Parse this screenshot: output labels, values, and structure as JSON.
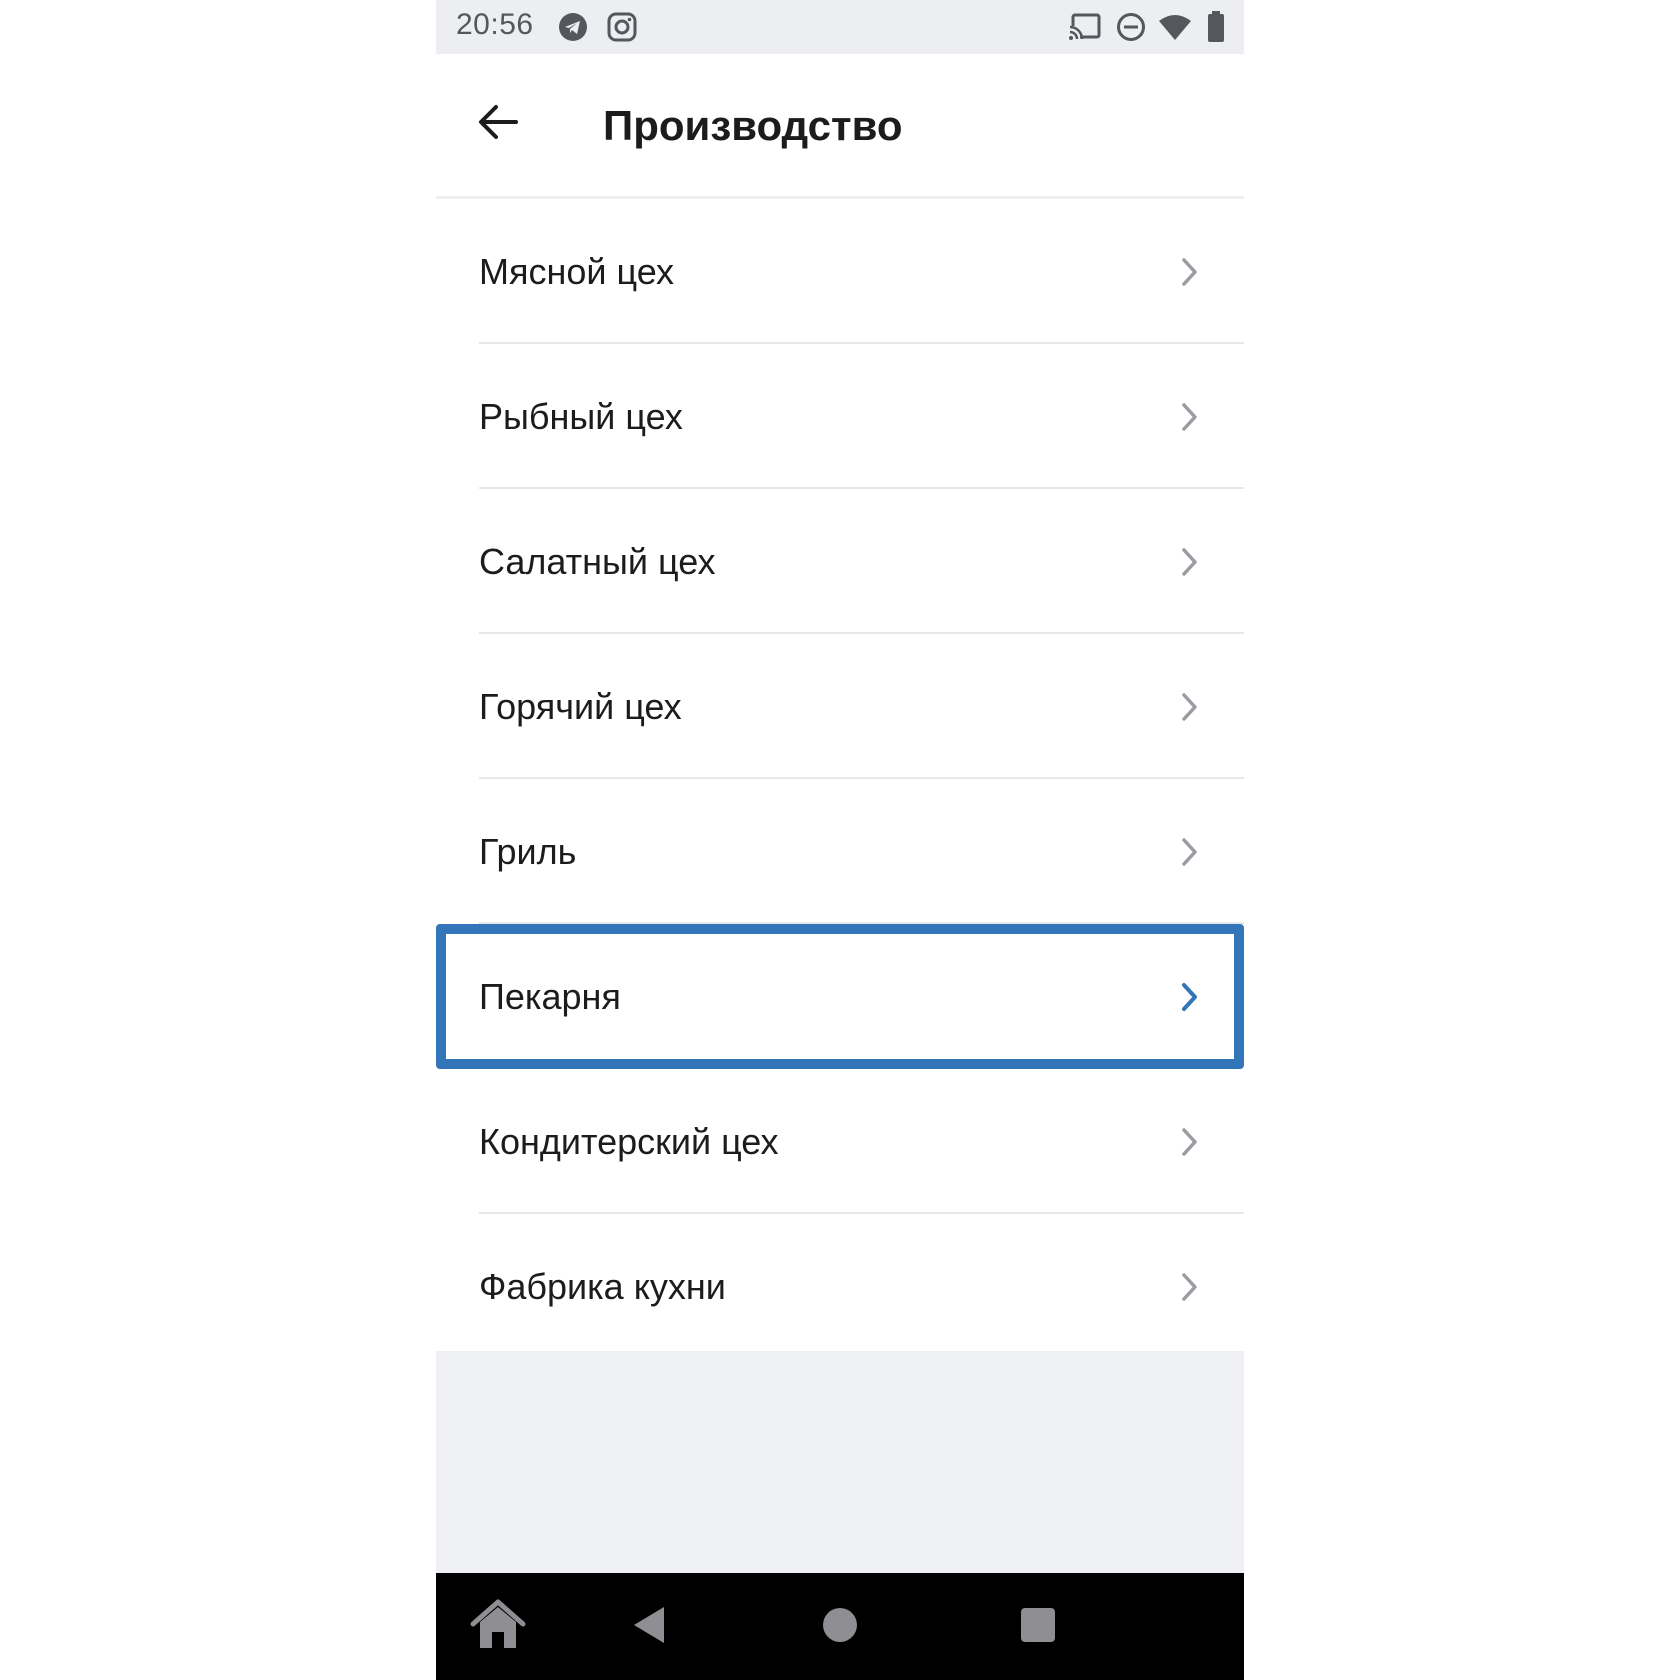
{
  "status_bar": {
    "time": "20:56",
    "left_icons": [
      "telegram-icon",
      "instagram-icon"
    ],
    "right_icons": [
      "cast-icon",
      "do-not-disturb-icon",
      "wifi-icon",
      "battery-icon"
    ]
  },
  "header": {
    "title": "Производство",
    "back_icon": "arrow-left-icon"
  },
  "list": {
    "items": [
      {
        "label": "Мясной цех"
      },
      {
        "label": "Рыбный цех"
      },
      {
        "label": "Салатный цех"
      },
      {
        "label": "Горячий цех"
      },
      {
        "label": "Гриль"
      },
      {
        "label": "Пекарня",
        "selected": true
      },
      {
        "label": "Кондитерский цех"
      },
      {
        "label": "Фабрика кухни"
      }
    ]
  },
  "nav_bar": {
    "buttons": [
      "home-icon",
      "back-triangle-icon",
      "home-circle-icon",
      "recents-square-icon"
    ]
  },
  "colors": {
    "accent": "#3275b8",
    "chevron": "#9a9ca1",
    "status_bar_bg": "#eceef2",
    "nav_bar_bg": "#000000"
  }
}
